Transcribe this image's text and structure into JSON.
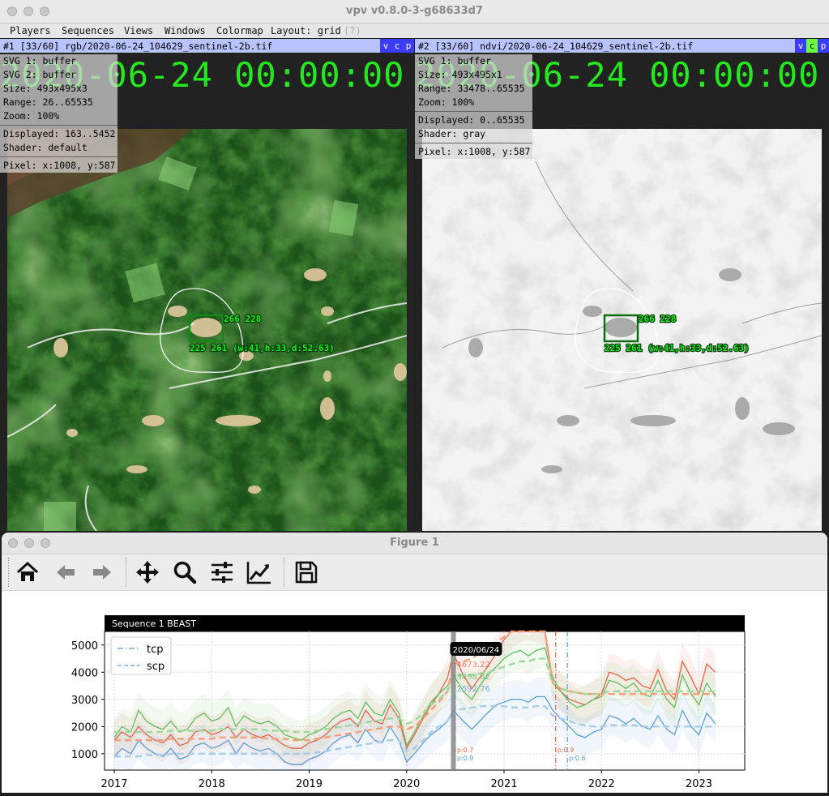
{
  "window": {
    "title": "vpv v0.8.0-3-g68633d7"
  },
  "menu": {
    "players": "Players",
    "sequences": "Sequences",
    "views": "Views",
    "windows": "Windows",
    "colormap": "Colormap",
    "layout": "Layout: grid",
    "layout_hint": "(?)"
  },
  "player1": {
    "header": "#1 [33/60] rgb/2020-06-24_104629_sentinel-2b.tif",
    "v": "v",
    "c": "c",
    "p": "p",
    "timestamp": "2020-06-24 00:00:00",
    "info": {
      "svg1": "SVG 1: buffer",
      "svg2": "SVG 2: buffer",
      "size": "Size: 493x495x3",
      "range": "Range: 26..65535",
      "zoom": "Zoom: 100%",
      "displayed": "Displayed: 163..5452",
      "shader": "Shader: default",
      "pixel": "Pixel: x:1008, y:587"
    },
    "roi_label_tr": "266 228",
    "roi_label_bl": "225 261 (w:41,h:33,d:52.63)"
  },
  "player2": {
    "header": "#2 [33/60] ndvi/2020-06-24_104629_sentinel-2b.tif",
    "v": "v",
    "c": "c",
    "p": "p",
    "timestamp": "2020-06-24 00:00:00",
    "info": {
      "svg1": "SVG 1: buffer",
      "size": "Size: 493x495x1",
      "range": "Range: 33478..65535",
      "zoom": "Zoom: 100%",
      "displayed": "Displayed: 0..65535",
      "shader": "Shader: gray",
      "pixel": "Pixel: x:1008, y:587"
    },
    "roi_label_tr": "266 228",
    "roi_label_bl": "225 261 (w:41,h:33,d:52.63)"
  },
  "figure": {
    "title": "Figure 1",
    "toolbar": [
      "home-icon",
      "back-arrow-icon",
      "forward-arrow-icon",
      "pan-icon",
      "zoom-icon",
      "subplots-icon",
      "axes-icon",
      "save-icon"
    ]
  },
  "chart_data": {
    "type": "line",
    "title": "Sequence 1 BEAST",
    "xlabel": "",
    "ylabel": "",
    "xlim": [
      2016.9,
      2023.47
    ],
    "ylim": [
      400,
      5500
    ],
    "xticks": [
      "2017",
      "2018",
      "2019",
      "2020",
      "2021",
      "2022",
      "2023"
    ],
    "yticks": [
      "1000",
      "2000",
      "3000",
      "4000",
      "5000"
    ],
    "grid": true,
    "legend": {
      "placement": "top-left",
      "entries": [
        "tcp",
        "scp"
      ]
    },
    "cursor": {
      "date": "2020/06/24",
      "x": 2020.48
    },
    "cursor_values": [
      "4673.22",
      "3898.82",
      "2592.76"
    ],
    "colors": {
      "red": "#e8634a",
      "green": "#5fbf5f",
      "blue": "#5a9fd4"
    },
    "x": [
      2017.0,
      2017.08,
      2017.17,
      2017.25,
      2017.33,
      2017.42,
      2017.5,
      2017.58,
      2017.67,
      2017.75,
      2017.83,
      2017.92,
      2018.0,
      2018.08,
      2018.17,
      2018.25,
      2018.33,
      2018.42,
      2018.5,
      2018.58,
      2018.67,
      2018.75,
      2018.83,
      2018.92,
      2019.0,
      2019.08,
      2019.17,
      2019.25,
      2019.33,
      2019.42,
      2019.5,
      2019.58,
      2019.67,
      2019.75,
      2019.83,
      2019.92,
      2020.0,
      2020.08,
      2020.17,
      2020.25,
      2020.33,
      2020.42,
      2020.48,
      2020.58,
      2020.67,
      2020.75,
      2020.83,
      2020.92,
      2021.0,
      2021.08,
      2021.17,
      2021.25,
      2021.33,
      2021.42,
      2021.5,
      2021.58,
      2021.67,
      2021.75,
      2021.83,
      2021.92,
      2022.0,
      2022.08,
      2022.17,
      2022.25,
      2022.33,
      2022.42,
      2022.5,
      2022.58,
      2022.67,
      2022.75,
      2022.83,
      2022.92,
      2023.0,
      2023.08,
      2023.17
    ],
    "series": [
      {
        "name": "",
        "color": "#e8634a",
        "values": [
          1500,
          1800,
          1600,
          2000,
          1700,
          1500,
          1400,
          1700,
          1300,
          1400,
          1800,
          1900,
          1700,
          1800,
          2000,
          1600,
          1900,
          1700,
          1600,
          1700,
          1500,
          1300,
          1200,
          1200,
          1400,
          1500,
          1700,
          2000,
          2200,
          2300,
          2000,
          2600,
          2200,
          2100,
          2800,
          2300,
          1200,
          1700,
          2300,
          2800,
          3200,
          3800,
          4700,
          3900,
          3400,
          3800,
          4200,
          4700,
          5200,
          5600,
          5800,
          5900,
          5800,
          5700,
          3600,
          3300,
          3000,
          2900,
          2800,
          3000,
          3200,
          4000,
          3900,
          3700,
          3800,
          3500,
          3400,
          4100,
          3300,
          3000,
          4400,
          3800,
          3200,
          4300,
          4000
        ]
      },
      {
        "name": "",
        "color": "#5fbf5f",
        "values": [
          1600,
          2000,
          1800,
          2600,
          2200,
          2000,
          1900,
          2200,
          1800,
          1900,
          2300,
          2500,
          2200,
          2300,
          2700,
          2000,
          2400,
          2200,
          2100,
          2200,
          2000,
          1700,
          1600,
          1500,
          1700,
          1800,
          2000,
          2300,
          2500,
          2600,
          2300,
          2900,
          2500,
          2400,
          3000,
          2500,
          1300,
          1800,
          2400,
          2900,
          3200,
          3500,
          3900,
          3300,
          3000,
          3500,
          3900,
          4200,
          4500,
          4700,
          4800,
          4600,
          4800,
          4900,
          3800,
          3300,
          2900,
          2700,
          2800,
          3000,
          3100,
          3700,
          3600,
          3400,
          3600,
          3200,
          3100,
          3700,
          3000,
          2700,
          3900,
          3200,
          2800,
          3600,
          3100
        ]
      },
      {
        "name": "",
        "color": "#5a9fd4",
        "values": [
          900,
          1200,
          1000,
          1500,
          1200,
          1000,
          900,
          1200,
          800,
          900,
          1300,
          1400,
          1200,
          1300,
          1500,
          1000,
          1400,
          1200,
          1100,
          1200,
          1000,
          700,
          600,
          600,
          800,
          900,
          1100,
          1400,
          1600,
          1700,
          1400,
          1900,
          1500,
          1400,
          2000,
          1500,
          700,
          1000,
          1400,
          1700,
          1900,
          2200,
          2600,
          2200,
          1900,
          2200,
          2500,
          2800,
          2900,
          3000,
          3000,
          2900,
          3100,
          3100,
          2600,
          2300,
          2000,
          1700,
          1600,
          1800,
          1900,
          2400,
          2300,
          2100,
          2300,
          2000,
          1900,
          2400,
          1900,
          1700,
          2600,
          2000,
          1700,
          2500,
          2100
        ]
      },
      {
        "name": "",
        "color": "#f4a07a",
        "dashed": true,
        "values": [
          1500,
          1500,
          1500,
          1500,
          1500,
          1500,
          1500,
          1550,
          1550,
          1550,
          1550,
          1550,
          1550,
          1600,
          1600,
          1600,
          1600,
          1600,
          1600,
          1550,
          1550,
          1550,
          1500,
          1500,
          1500,
          1550,
          1600,
          1650,
          1700,
          1750,
          1800,
          1850,
          1900,
          1950,
          2000,
          2000,
          1900,
          2000,
          2300,
          2600,
          2900,
          3300,
          4300,
          4400,
          4500,
          4700,
          4900,
          5100,
          5300,
          5500,
          5600,
          5700,
          5600,
          5500,
          3600,
          3400,
          3300,
          3250,
          3200,
          3200,
          3200,
          3200,
          3200,
          3200,
          3200,
          3200,
          3200,
          3200,
          3200,
          3200,
          3200,
          3200,
          3200,
          3200,
          3200
        ]
      },
      {
        "name": "",
        "color": "#9fd99f",
        "dashed": true,
        "values": [
          1800,
          1800,
          1800,
          1800,
          1800,
          1800,
          1800,
          1850,
          1850,
          1850,
          1850,
          1850,
          1850,
          1900,
          1900,
          1900,
          1900,
          1900,
          1900,
          1850,
          1850,
          1850,
          1800,
          1800,
          1800,
          1850,
          1900,
          1950,
          2000,
          2050,
          2100,
          2150,
          2200,
          2250,
          2300,
          2300,
          2100,
          2200,
          2500,
          2800,
          3000,
          3300,
          3850,
          3900,
          3900,
          3950,
          4000,
          4100,
          4200,
          4300,
          4400,
          4400,
          4500,
          4500,
          3600,
          3400,
          3300,
          3250,
          3200,
          3200,
          3200,
          3300,
          3300,
          3300,
          3300,
          3300,
          3300,
          3300,
          3300,
          3300,
          3300,
          3300,
          3300,
          3300,
          3300
        ]
      },
      {
        "name": "",
        "color": "#a9cde9",
        "dashed": true,
        "values": [
          900,
          900,
          900,
          900,
          950,
          950,
          950,
          1000,
          1000,
          1000,
          1000,
          1000,
          1000,
          1000,
          1000,
          1000,
          1000,
          1000,
          1000,
          1000,
          1000,
          1000,
          1000,
          1000,
          1000,
          1050,
          1100,
          1150,
          1200,
          1250,
          1300,
          1350,
          1400,
          1450,
          1500,
          1500,
          1100,
          1200,
          1500,
          1800,
          2000,
          2200,
          2600,
          2650,
          2700,
          2750,
          2750,
          2750,
          2750,
          2700,
          2700,
          2700,
          2750,
          2750,
          2400,
          2300,
          2200,
          2100,
          2050,
          2000,
          2000,
          2050,
          2050,
          2050,
          2050,
          2000,
          2000,
          2000,
          2000,
          2000,
          2000,
          2000,
          2000,
          2000,
          2000
        ]
      }
    ],
    "vlines": [
      {
        "x": 2020.5,
        "color": "#e8634a",
        "label": "p:0.7"
      },
      {
        "x": 2020.5,
        "color": "#5a9fd4",
        "label": "p:0.9"
      },
      {
        "x": 2021.53,
        "color": "#e8634a",
        "label": "p:0.9"
      },
      {
        "x": 2021.65,
        "color": "#5a9fd4",
        "label": "p:0.6"
      }
    ]
  }
}
